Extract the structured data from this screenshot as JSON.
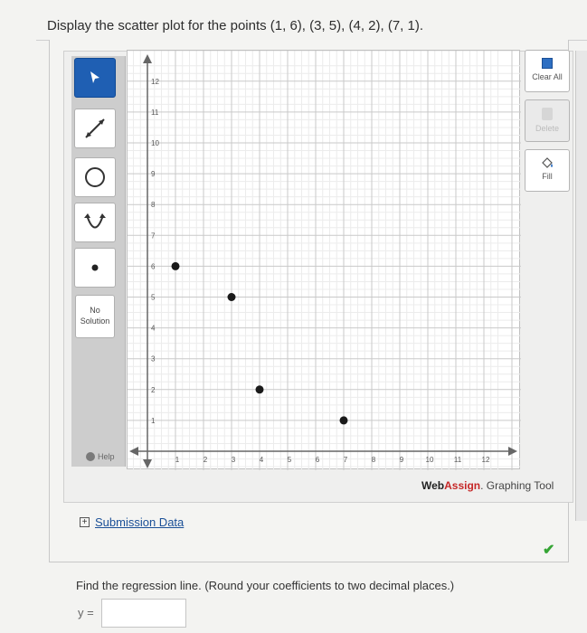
{
  "question": {
    "text": "Display the scatter plot for the points (1, 6), (3, 5), (4, 2), (7, 1)."
  },
  "toolbar": {
    "items": [
      {
        "name": "pointer",
        "active": true
      },
      {
        "name": "line"
      },
      {
        "name": "circle"
      },
      {
        "name": "parabola"
      },
      {
        "name": "point"
      }
    ],
    "no_solution_line1": "No",
    "no_solution_line2": "Solution",
    "help_label": "Help"
  },
  "side_buttons": {
    "clear_all_label": "Clear All",
    "delete_label": "Delete",
    "fill_label": "Fill"
  },
  "chart_data": {
    "type": "scatter",
    "x": [
      1,
      3,
      4,
      7
    ],
    "y": [
      6,
      5,
      2,
      1
    ],
    "xlim": [
      -0.5,
      12.5
    ],
    "ylim": [
      -0.5,
      12.5
    ],
    "x_tick_labels": [
      "1",
      "2",
      "3",
      "4",
      "5",
      "6",
      "7",
      "8",
      "9",
      "10",
      "11",
      "12"
    ],
    "y_tick_labels": [
      "1",
      "2",
      "3",
      "4",
      "5",
      "6",
      "7",
      "8",
      "9",
      "10",
      "11",
      "12"
    ],
    "grid": true,
    "minor_grid_step": 0.25,
    "point_color": "#1a1a1a"
  },
  "brand": {
    "web": "Web",
    "assign": "Assign",
    "suffix": ". Graphing Tool"
  },
  "submission": {
    "label": "Submission Data",
    "toggle": "+"
  },
  "regression": {
    "prompt": "Find the regression line. (Round your coefficients to two decimal places.)",
    "y_label": "y =",
    "y_value": ""
  }
}
